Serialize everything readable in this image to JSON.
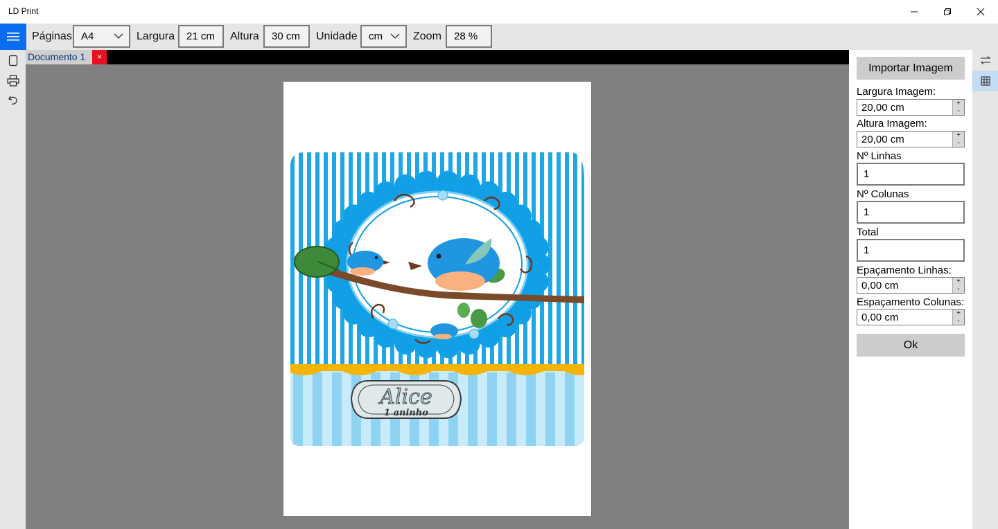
{
  "window": {
    "title": "LD Print"
  },
  "toolbar": {
    "pages_label": "Páginas",
    "pages_value": "A4",
    "width_label": "Largura",
    "width_value": "21 cm",
    "height_label": "Altura",
    "height_value": "30 cm",
    "unit_label": "Unidade",
    "unit_value": "cm",
    "zoom_label": "Zoom",
    "zoom_value": "28 %"
  },
  "tabs": [
    {
      "label": "Documento 1",
      "close": "×"
    }
  ],
  "image": {
    "main_text": "Alice",
    "sub_text": "1 aninho"
  },
  "panel": {
    "import_button": "Importar Imagem",
    "image_width_label": "Largura Imagem:",
    "image_width_value": "20,00 cm",
    "image_height_label": "Altura Imagem:",
    "image_height_value": "20,00 cm",
    "rows_label": "Nº Linhas",
    "rows_value": "1",
    "cols_label": "Nº Colunas",
    "cols_value": "1",
    "total_label": "Total",
    "total_value": "1",
    "row_spacing_label": "Epaçamento Linhas:",
    "row_spacing_value": "0,00 cm",
    "col_spacing_label": "Espaçamento Colunas:",
    "col_spacing_value": "0,00 cm",
    "ok_button": "Ok",
    "spin_up": "+",
    "spin_down": "-"
  },
  "colors": {
    "accent": "#0a6df0",
    "stripe_blue": "#1ea7e4",
    "light_stripe": "#8fd3f3",
    "bird_blue": "#2196e0",
    "branch_brown": "#7b4a2a"
  },
  "icons": {
    "menu": "hamburger-icon",
    "new": "page-icon",
    "print": "printer-icon",
    "undo": "undo-icon",
    "swap": "swap-arrows-icon",
    "grid": "grid-icon"
  }
}
